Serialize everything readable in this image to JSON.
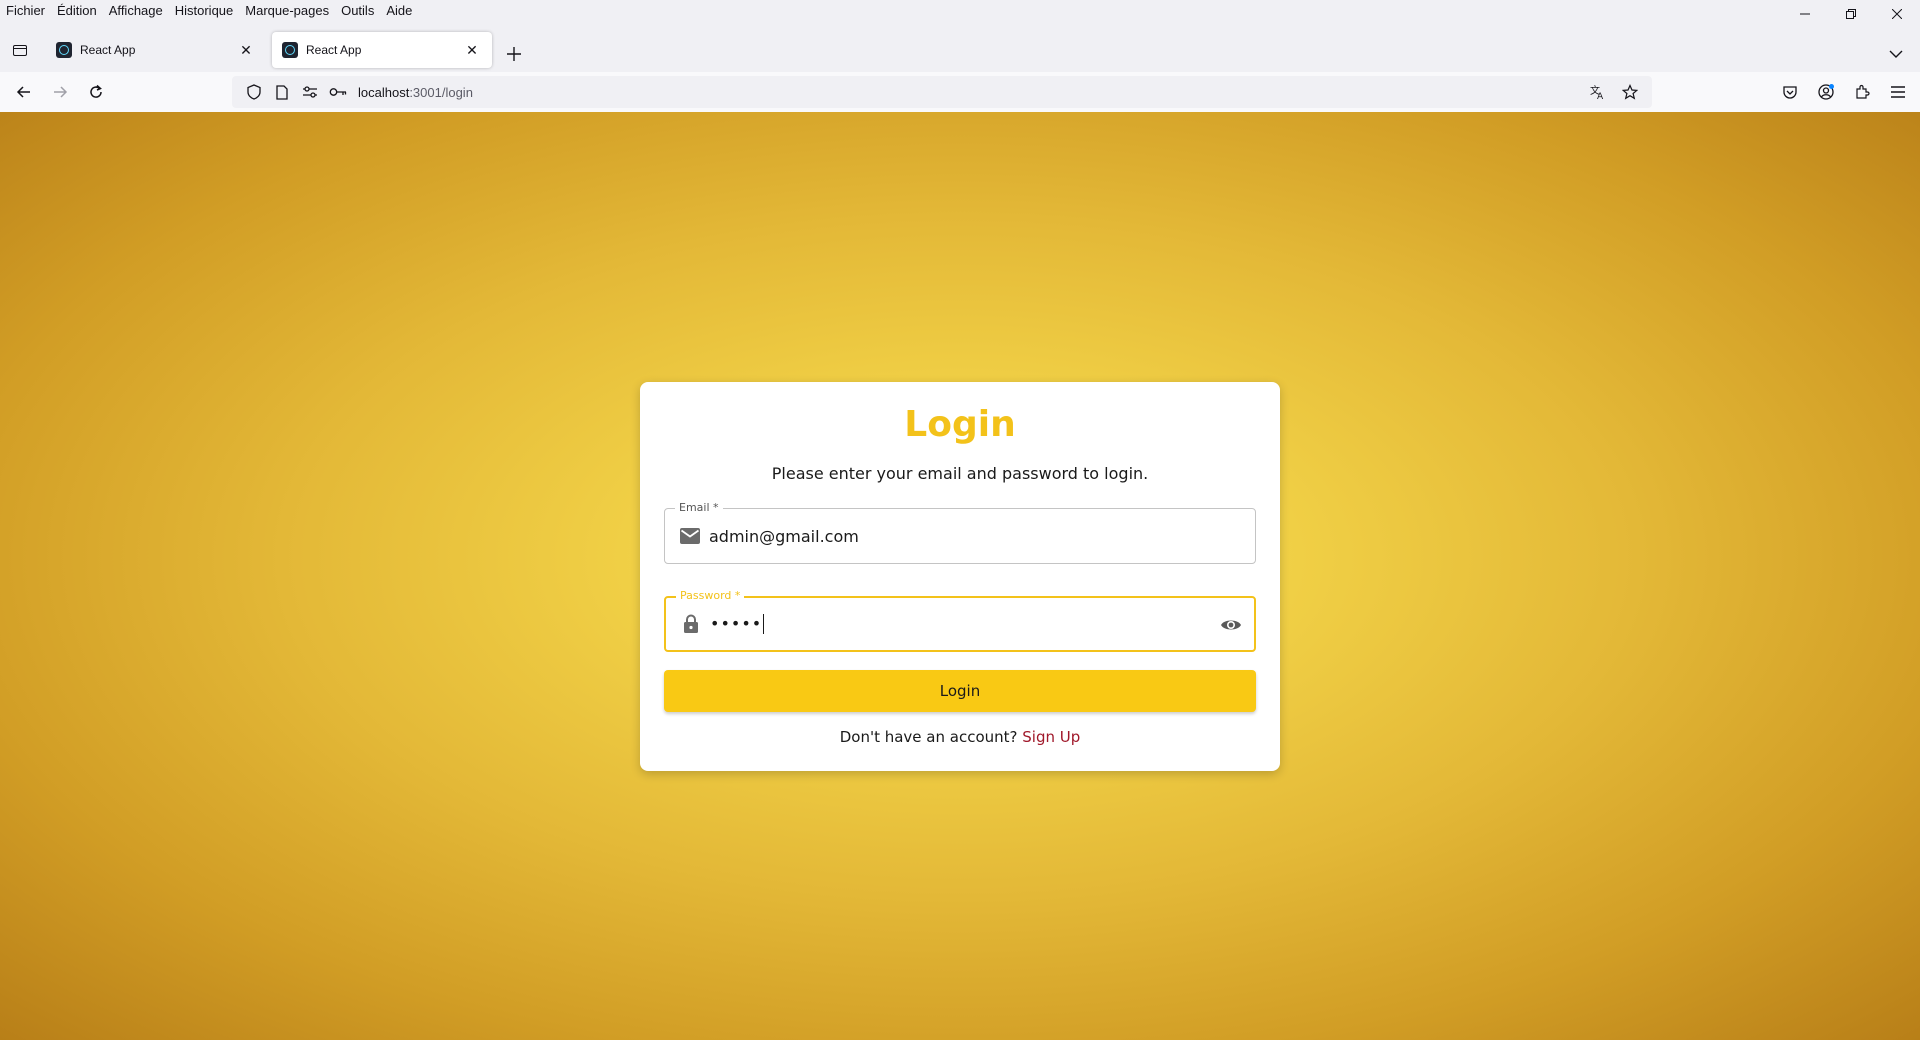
{
  "menu": [
    "Fichier",
    "Édition",
    "Affichage",
    "Historique",
    "Marque-pages",
    "Outils",
    "Aide"
  ],
  "tabs": [
    {
      "title": "React App"
    },
    {
      "title": "React App"
    }
  ],
  "url": {
    "host": "localhost",
    "path": ":3001/login"
  },
  "colors": {
    "accent": "#f3c21a",
    "button": "#f9c914",
    "link": "#a0182a"
  },
  "login": {
    "title": "Login",
    "subtitle": "Please enter your email and password to login.",
    "email_label": "Email *",
    "email_value": "admin@gmail.com",
    "password_label": "Password *",
    "password_masked": "•••••",
    "button_label": "Login",
    "signup_prompt": "Don't have an account?",
    "signup_link": "Sign Up"
  }
}
